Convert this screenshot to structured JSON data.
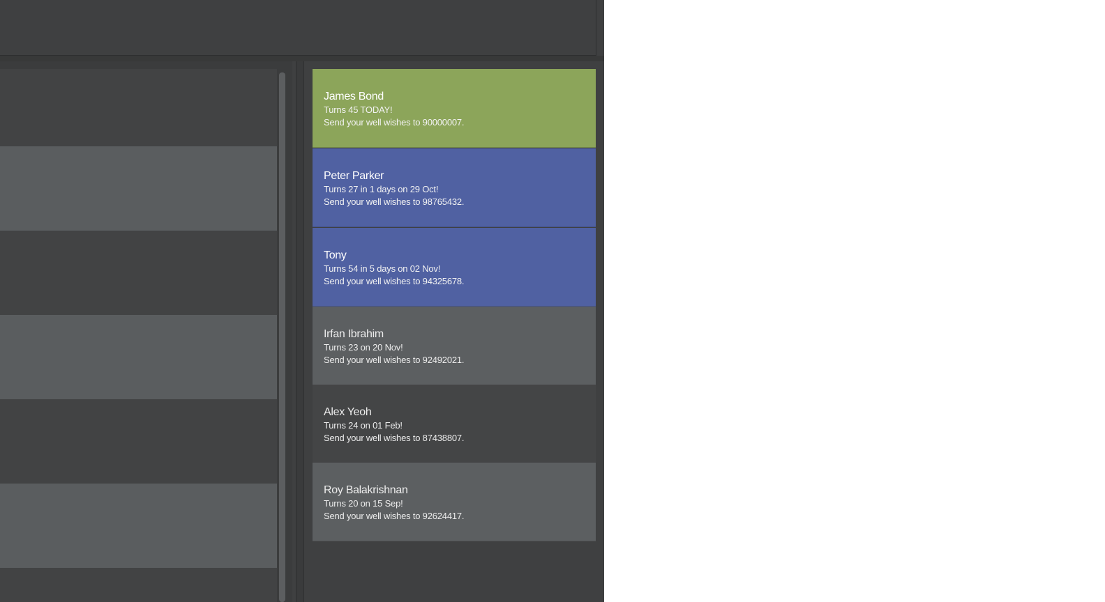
{
  "birthdays": [
    {
      "name": "James Bond",
      "turns": "Turns 45 TODAY!",
      "wishes": "Send your well wishes to 90000007.",
      "status": "today"
    },
    {
      "name": "Peter Parker",
      "turns": "Turns 27 in 1 days on 29 Oct!",
      "wishes": "Send your well wishes to 98765432.",
      "status": "soon"
    },
    {
      "name": "Tony",
      "turns": "Turns 54 in 5 days on 02 Nov!",
      "wishes": "Send your well wishes to 94325678.",
      "status": "soon"
    },
    {
      "name": "Irfan Ibrahim",
      "turns": "Turns 23 on 20 Nov!",
      "wishes": "Send your well wishes to 92492021.",
      "status": "later"
    },
    {
      "name": "Alex Yeoh",
      "turns": "Turns 24 on 01 Feb!",
      "wishes": "Send your well wishes to 87438807.",
      "status": "later"
    },
    {
      "name": "Roy Balakrishnan",
      "turns": "Turns 20 on 15 Sep!",
      "wishes": "Send your well wishes to 92624417.",
      "status": "later"
    }
  ],
  "colors": {
    "today": "#8ca55a",
    "soon": "#5061a2",
    "later_light": "#5c5f61",
    "later_dark": "#444546",
    "window_background": "#3f4041"
  }
}
